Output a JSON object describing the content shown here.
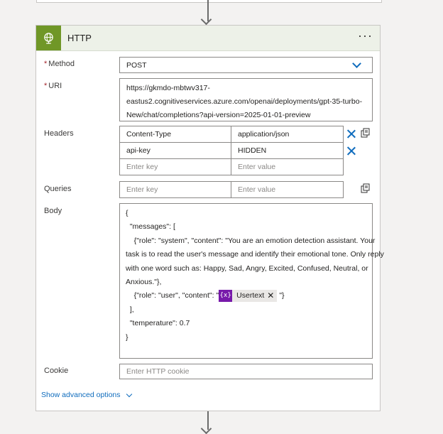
{
  "action": {
    "title": "HTTP",
    "more_label": "···"
  },
  "method": {
    "label": "Method",
    "required_mark": "*",
    "value": "POST"
  },
  "uri": {
    "label": "URI",
    "required_mark": "*",
    "lines": [
      "https://gkmdo-mbtwv317-",
      "eastus2.cognitiveservices.azure.com/openai/deployments/gpt-35-turbo-",
      "New/chat/completions?api-version=2025-01-01-preview"
    ]
  },
  "headers": {
    "label": "Headers",
    "rows": [
      {
        "key": "Content-Type",
        "value": "application/json"
      },
      {
        "key": "api-key",
        "value": "HIDDEN"
      }
    ],
    "key_placeholder": "Enter key",
    "value_placeholder": "Enter value"
  },
  "queries": {
    "label": "Queries",
    "key_placeholder": "Enter key",
    "value_placeholder": "Enter value"
  },
  "body": {
    "label": "Body",
    "lines": [
      "{",
      "  \"messages\": [",
      "    {\"role\": \"system\", \"content\": \"You are an emotion detection assistant. Your",
      "task is to read the user's message and identify their emotional tone. Only reply",
      "with one word such as: Happy, Sad, Angry, Excited, Confused, Neutral, or",
      "Anxious.\"},",
      "    {\"role\": \"user\", \"content\": \"",
      "\"}",
      "  ],",
      "  \"temperature\": 0.7",
      "}"
    ],
    "token": {
      "icon_text": "{x}",
      "label": "Usertext",
      "remove": "✕",
      "icon_color": "#7719aa"
    }
  },
  "cookie": {
    "label": "Cookie",
    "placeholder": "Enter HTTP cookie"
  },
  "advanced_link": "Show advanced options",
  "colors": {
    "accent": "#0f6cbd",
    "action_icon": "#709727",
    "required": "#a4262c"
  }
}
